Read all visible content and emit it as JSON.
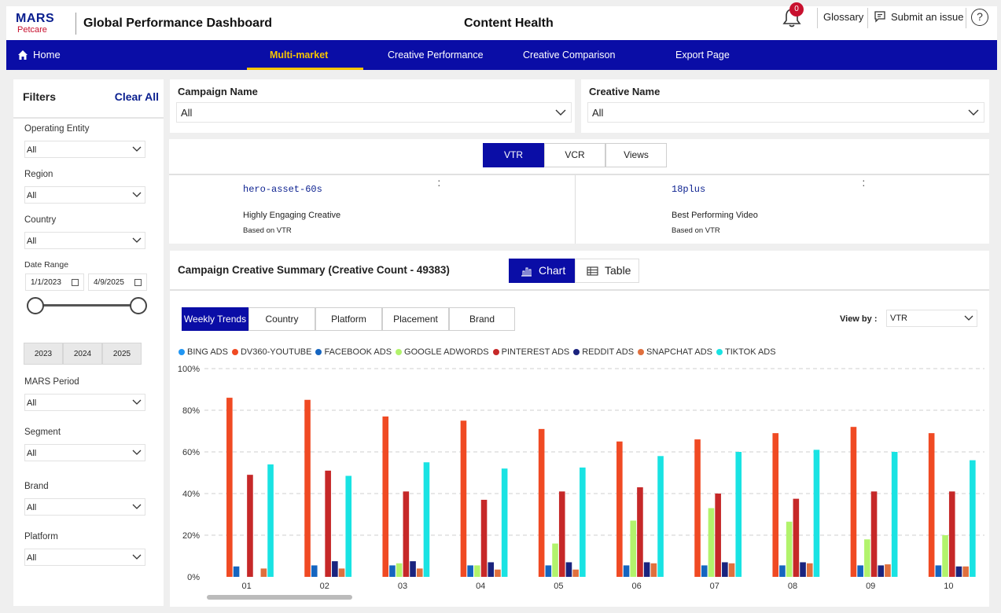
{
  "header": {
    "logo_brand": "MARS",
    "logo_sub": "Petcare",
    "app_title": "Global Performance Dashboard",
    "page_title": "Content Health",
    "notification_count": "0",
    "glossary_label": "Glossary",
    "submit_label": "Submit an issue",
    "help_label": "?"
  },
  "nav": {
    "home_label": "Home",
    "items": [
      {
        "label": "Multi-market"
      },
      {
        "label": "Creative Performance"
      },
      {
        "label": "Creative Comparison"
      },
      {
        "label": "Export Page"
      }
    ]
  },
  "filters": {
    "title": "Filters",
    "clear_all": "Clear All",
    "operating_entity": {
      "label": "Operating Entity",
      "value": "All"
    },
    "region": {
      "label": "Region",
      "value": "All"
    },
    "country": {
      "label": "Country",
      "value": "All"
    },
    "date_range": {
      "label": "Date Range",
      "start": "1/1/2023",
      "end": "4/9/2025"
    },
    "years": [
      "2023",
      "2024",
      "2025"
    ],
    "mars_period": {
      "label": "MARS Period",
      "value": "All"
    },
    "segment": {
      "label": "Segment",
      "value": "All"
    },
    "brand": {
      "label": "Brand",
      "value": "All"
    },
    "platform": {
      "label": "Platform",
      "value": "All"
    }
  },
  "selectors": {
    "campaign": {
      "label": "Campaign Name",
      "value": "All"
    },
    "creative": {
      "label": "Creative Name",
      "value": "All"
    }
  },
  "metric_toggle": {
    "buttons": [
      "VTR",
      "VCR",
      "Views"
    ],
    "active": "VTR"
  },
  "kpis": [
    {
      "name": "hero-asset-60s",
      "desc": "Highly Engaging Creative",
      "sub": "Based on VTR"
    },
    {
      "name": "18plus",
      "desc": "Best Performing Video",
      "sub": "Based on VTR"
    }
  ],
  "summary": {
    "title": "Campaign Creative Summary (Creative Count - 49383)",
    "chart_btn": "Chart",
    "table_btn": "Table",
    "tabs": [
      "Weekly Trends",
      "Country",
      "Platform",
      "Placement",
      "Brand"
    ],
    "view_by_label": "View by :",
    "view_by_value": "VTR"
  },
  "chart_data": {
    "type": "bar",
    "categories": [
      "01",
      "02",
      "03",
      "04",
      "05",
      "06",
      "07",
      "08",
      "09",
      "10"
    ],
    "y_ticks": [
      "0%",
      "20%",
      "40%",
      "60%",
      "80%",
      "100%"
    ],
    "ylim": [
      0,
      100
    ],
    "grid": true,
    "legend_position": "top-left",
    "series": [
      {
        "name": "BING ADS",
        "color": "#2196f3",
        "values": [
          0,
          0,
          0,
          0,
          0,
          0,
          0,
          0,
          0,
          0
        ]
      },
      {
        "name": "DV360-YOUTUBE",
        "color": "#f04a23",
        "values": [
          86,
          85,
          77,
          75,
          71,
          65,
          66,
          69,
          72,
          69
        ]
      },
      {
        "name": "FACEBOOK ADS",
        "color": "#1565c0",
        "values": [
          5,
          5.5,
          5.5,
          5.5,
          5.5,
          5.5,
          5.5,
          5.5,
          5.5,
          5.5
        ]
      },
      {
        "name": "GOOGLE ADWORDS",
        "color": "#b2f36c",
        "values": [
          0,
          0,
          6.5,
          5.5,
          16,
          27,
          33,
          26.5,
          18,
          20
        ]
      },
      {
        "name": "PINTEREST ADS",
        "color": "#c62828",
        "values": [
          49,
          51,
          41,
          37,
          41,
          43,
          40,
          37.5,
          41,
          41
        ]
      },
      {
        "name": "REDDIT ADS",
        "color": "#1a237e",
        "values": [
          0,
          7.5,
          7.5,
          7,
          7,
          7,
          7,
          7,
          5.5,
          5
        ]
      },
      {
        "name": "SNAPCHAT ADS",
        "color": "#e0703e",
        "values": [
          4,
          4,
          4,
          3.5,
          3.5,
          6.5,
          6.5,
          6.5,
          6,
          5
        ]
      },
      {
        "name": "TIKTOK ADS",
        "color": "#19e3e3",
        "values": [
          54,
          48.5,
          55,
          52,
          52.5,
          58,
          60,
          61,
          60,
          56
        ]
      }
    ]
  }
}
